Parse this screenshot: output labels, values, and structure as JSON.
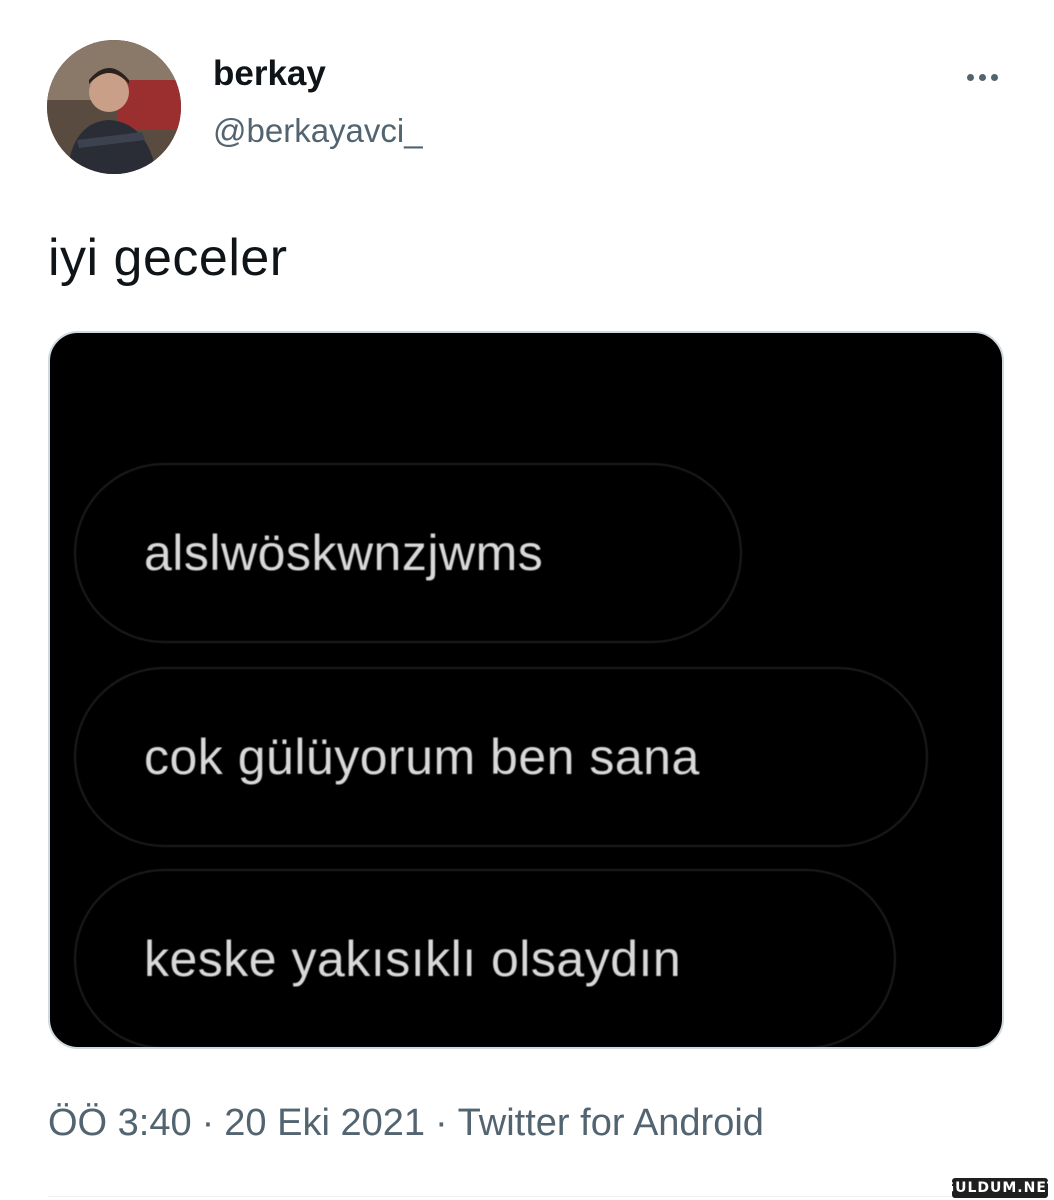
{
  "user": {
    "display_name": "berkay",
    "handle": "@berkayavci_",
    "avatar_icon": "profile-photo"
  },
  "tweet": {
    "text": "iyi geceler",
    "media": {
      "bubbles": [
        "alslwöskwnzjwms",
        "cok gülüyorum ben sana",
        "keske yakısıklı olsaydın"
      ]
    }
  },
  "meta": {
    "time": "ÖÖ 3:40",
    "separator": "·",
    "date": "20 Eki 2021",
    "source": "Twitter for Android"
  },
  "more_icon": "more-horizontal-icon",
  "watermark": "GULDUM.NET",
  "colors": {
    "text_primary": "#0f1419",
    "text_secondary": "#536471",
    "media_background": "#000000",
    "bubble_text": "#d9d9d9"
  }
}
